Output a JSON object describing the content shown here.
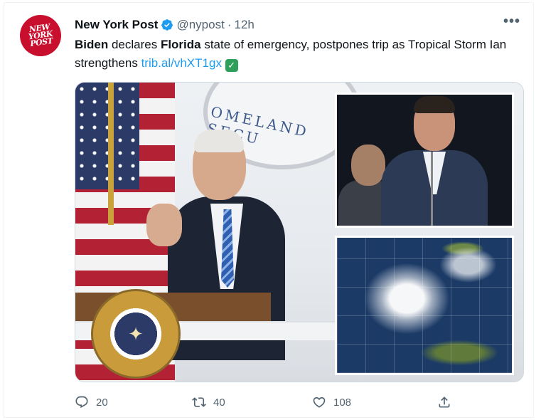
{
  "tweet": {
    "author": {
      "name": "New York Post",
      "handle": "@nypost",
      "separator": "·",
      "time": "12h",
      "avatar_lines": [
        "NEW",
        "YORK",
        "POST"
      ],
      "verified": true
    },
    "text": {
      "part1_bold": "Biden",
      "part2": " declares ",
      "part3_bold": "Florida",
      "part4": " state of emergency, postpones trip as Tropical Storm Ian strengthens ",
      "link": "trib.al/vhXT1gx",
      "emoji": "✓"
    },
    "media": {
      "seal_text": "OMELAND SECU",
      "description_icon": "photo"
    },
    "actions": {
      "reply_count": "20",
      "retweet_count": "40",
      "like_count": "108"
    },
    "more_label": "•••"
  },
  "colors": {
    "accent": "#1d9bf0",
    "brand": "#c8102e",
    "secondary_text": "#536471"
  }
}
